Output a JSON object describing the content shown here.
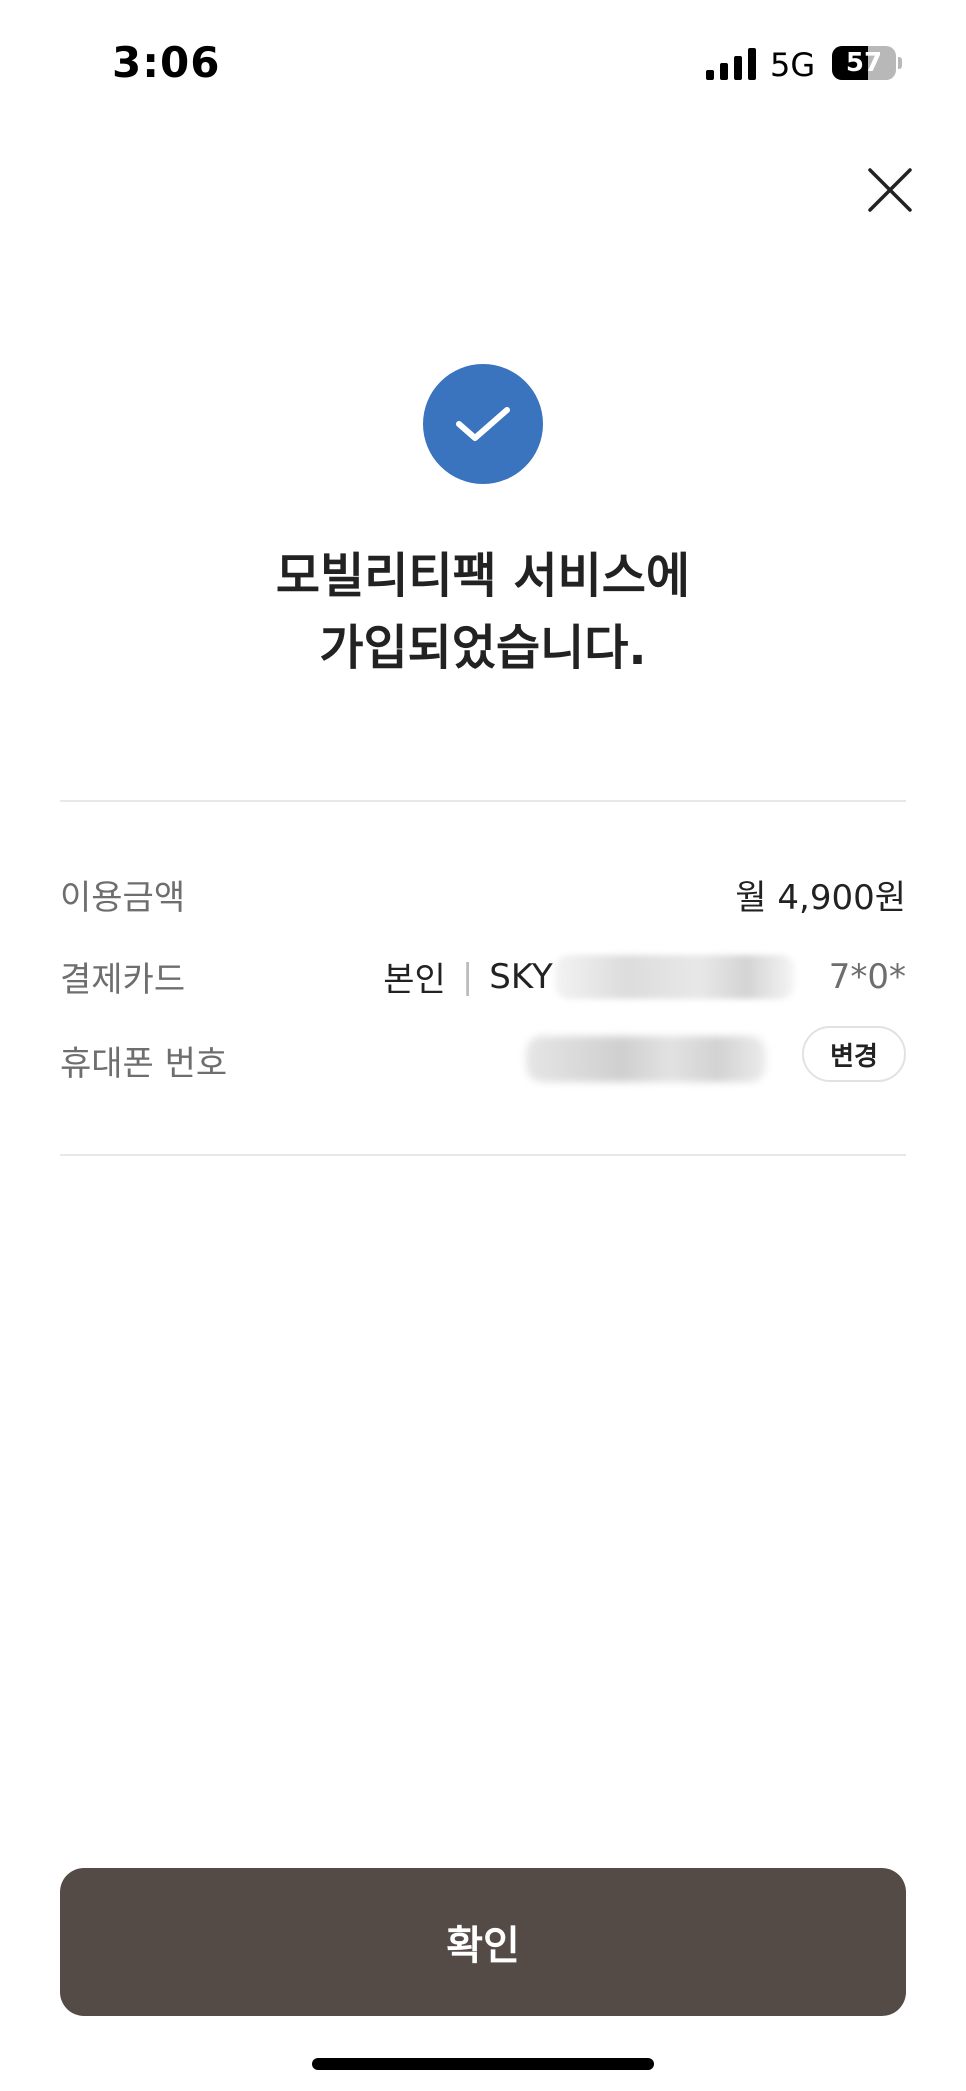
{
  "status_bar": {
    "time": "3:06",
    "network": "5G",
    "battery_level": "57",
    "battery_fraction": 0.57
  },
  "header": {
    "close_icon": "close-icon"
  },
  "success": {
    "icon": "check-icon",
    "icon_color": "#3a73be",
    "title_line1": "모빌리티팩 서비스에",
    "title_line2": "가입되었습니다."
  },
  "details": {
    "amount": {
      "label": "이용금액",
      "value": "월 4,900원"
    },
    "card": {
      "label": "결제카드",
      "owner": "본인",
      "separator": "|",
      "issuer": "SKY",
      "number_tail": "7*0*"
    },
    "phone": {
      "label": "휴대폰 번호",
      "change_label": "변경"
    }
  },
  "footer": {
    "confirm_label": "확인",
    "button_color": "#544a46"
  }
}
